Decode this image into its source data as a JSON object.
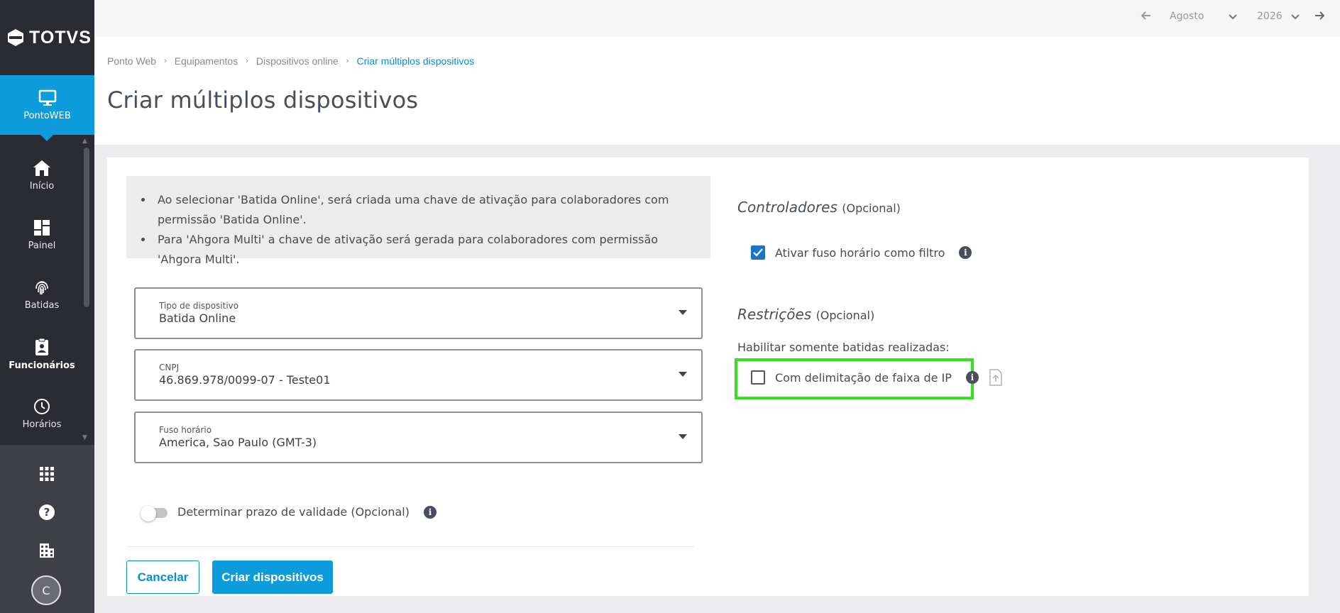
{
  "app": {
    "brand": "TOTVS",
    "module": "PontoWEB"
  },
  "sidebar": {
    "items": [
      {
        "label": "Início",
        "icon": "home-icon"
      },
      {
        "label": "Painel",
        "icon": "dashboard-icon"
      },
      {
        "label": "Batidas",
        "icon": "fingerprint-icon"
      },
      {
        "label": "Funcionários",
        "icon": "badge-icon"
      },
      {
        "label": "Horários",
        "icon": "clock-icon"
      }
    ],
    "avatar_initial": "C"
  },
  "topbar": {
    "month": "Agosto",
    "year": "2026"
  },
  "breadcrumb": [
    "Ponto Web",
    "Equipamentos",
    "Dispositivos online",
    "Criar múltiplos dispositivos"
  ],
  "page_title": "Criar múltiplos dispositivos",
  "info_box": {
    "lines": [
      "Ao selecionar 'Batida Online', será criada uma chave de ativação para colaboradores com permissão 'Batida Online'.",
      "Para 'Ahgora Multi' a chave de ativação será gerada para colaboradores com permissão 'Ahgora Multi'."
    ]
  },
  "fields": {
    "tipo": {
      "label": "Tipo de dispositivo",
      "value": "Batida Online"
    },
    "cnpj": {
      "label": "CNPJ",
      "value": "46.869.978/0099-07 - Teste01"
    },
    "fuso": {
      "label": "Fuso horário",
      "value": "America, Sao Paulo (GMT-3)"
    }
  },
  "toggle": {
    "label": "Determinar prazo de validade (Opcional)",
    "on": false
  },
  "buttons": {
    "cancel": "Cancelar",
    "create": "Criar dispositivos"
  },
  "controladores": {
    "title": "Controladores",
    "optional": "(Opcional)",
    "checkbox_label": "Ativar fuso horário como filtro",
    "checked": true
  },
  "restricoes": {
    "title": "Restrições",
    "optional": "(Opcional)",
    "sub_label": "Habilitar somente batidas realizadas:",
    "checkbox_label": "Com delimitação de faixa de IP",
    "checked": false
  },
  "colors": {
    "accent": "#0c9cdc",
    "sidebar": "#2b2c33",
    "highlight": "#35e11d",
    "checkbox": "#1d74c7"
  }
}
